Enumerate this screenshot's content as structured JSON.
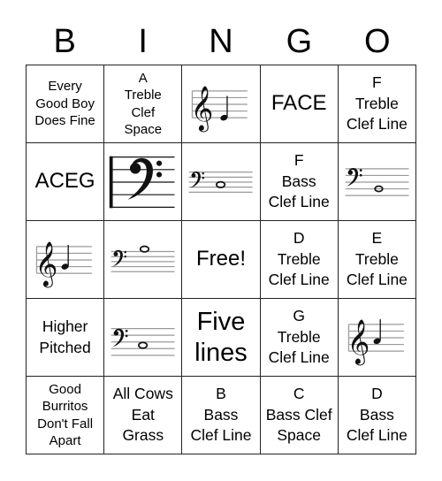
{
  "header": {
    "letters": [
      "B",
      "I",
      "N",
      "G",
      "O"
    ]
  },
  "card": {
    "cells": [
      {
        "type": "text",
        "text": "Every\nGood Boy\nDoes Fine",
        "size": "sm"
      },
      {
        "type": "text",
        "text": "A\nTreble\nClef\nSpace",
        "size": "sm"
      },
      {
        "type": "image",
        "image": "treble-clef-staff-note-e",
        "text": ""
      },
      {
        "type": "text",
        "text": "FACE",
        "size": "lg"
      },
      {
        "type": "text",
        "text": "F\nTreble\nClef Line",
        "size": "md"
      },
      {
        "type": "text",
        "text": "ACEG",
        "size": "lg"
      },
      {
        "type": "image",
        "image": "bass-clef-large",
        "text": ""
      },
      {
        "type": "image",
        "image": "bass-clef-staff-note-c",
        "text": ""
      },
      {
        "type": "text",
        "text": "F\nBass\nClef Line",
        "size": "md"
      },
      {
        "type": "image",
        "image": "bass-clef-staff-note-b",
        "text": ""
      },
      {
        "type": "image",
        "image": "treble-clef-staff-note-g",
        "text": ""
      },
      {
        "type": "image",
        "image": "bass-clef-staff-note-g",
        "text": ""
      },
      {
        "type": "text",
        "text": "Free!",
        "size": "lg"
      },
      {
        "type": "text",
        "text": "D\nTreble\nClef Line",
        "size": "md"
      },
      {
        "type": "text",
        "text": "E\nTreble\nClef Line",
        "size": "md"
      },
      {
        "type": "text",
        "text": "Higher\nPitched",
        "size": "md"
      },
      {
        "type": "image",
        "image": "bass-clef-staff-note-d",
        "text": ""
      },
      {
        "type": "text",
        "text": "Five\nlines",
        "size": "xl"
      },
      {
        "type": "text",
        "text": "G\nTreble\nClef Line",
        "size": "md"
      },
      {
        "type": "image",
        "image": "treble-clef-staff-note-a",
        "text": ""
      },
      {
        "type": "text",
        "text": "Good\nBurritos\nDon't Fall\nApart",
        "size": "sm"
      },
      {
        "type": "text",
        "text": "All Cows\nEat\nGrass",
        "size": "md"
      },
      {
        "type": "text",
        "text": "B\nBass\nClef Line",
        "size": "md"
      },
      {
        "type": "text",
        "text": "C\nBass Clef\nSpace",
        "size": "md"
      },
      {
        "type": "text",
        "text": "D\nBass\nClef Line",
        "size": "md"
      }
    ]
  }
}
